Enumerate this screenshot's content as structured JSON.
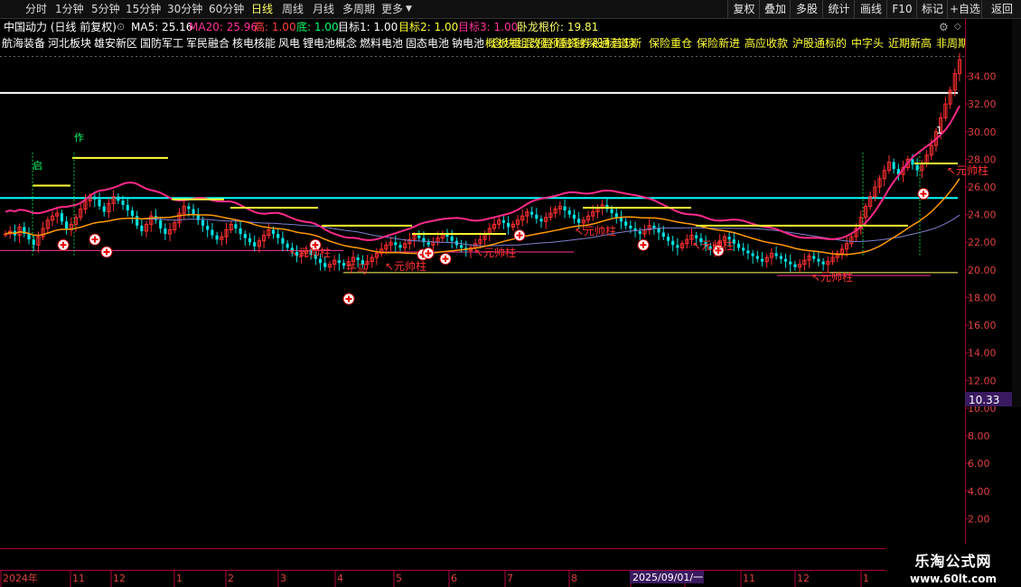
{
  "toolbar": {
    "periods": [
      "分时",
      "1分钟",
      "5分钟",
      "15分钟",
      "30分钟",
      "60分钟",
      "日线",
      "周线",
      "月线",
      "多周期",
      "更多"
    ],
    "active_index": 6,
    "right_buttons": [
      "复权",
      "叠加",
      "多股",
      "统计",
      "画线",
      "F10",
      "标记",
      "+自选",
      "返回"
    ]
  },
  "info": {
    "stock_title": "中国动力 (日线 前复权)",
    "ma5": "MA5: 25.16",
    "ma20": "MA20: 25.96",
    "high": "高: 1.00",
    "low": "底: 1.00",
    "target1": "目标1: 1.00",
    "target2": "目标2: 1.00",
    "target3": "目标3: 1.00",
    "wolong": "卧龙根价: 19.81"
  },
  "sectors": [
    "航海装备",
    "河北板块",
    "雄安新区",
    "国防军工",
    "军民融合",
    "核电核能",
    "风电",
    "锂电池概念",
    "燃料电池",
    "固态电池",
    "钠电池"
  ],
  "sectors_overlap": "概念板块重组混改预盈预增融资融券深股通标普道琼斯",
  "sectors_tail": [
    "保险重仓",
    "保险新进",
    "高应收款",
    "沪股通标的",
    "中字头",
    "近期新高",
    "非周期股"
  ],
  "price_axis": {
    "ticks": [
      "34.00",
      "32.00",
      "30.00",
      "28.00",
      "26.00",
      "24.00",
      "22.00",
      "20.00",
      "18.00",
      "16.00",
      "14.00",
      "12.00",
      "10.00",
      "8.00",
      "6.00",
      "4.00",
      "2.00"
    ],
    "current_tag": "10.33"
  },
  "time_axis": {
    "labels": [
      "2024年",
      "11",
      "12",
      "1",
      "2",
      "3",
      "4",
      "5",
      "6",
      "7",
      "8",
      "9",
      "10",
      "11",
      "12",
      "1"
    ],
    "cursor_label": "2025/09/01/一"
  },
  "annotations": {
    "yuanshuai": "元帅柱",
    "qianma": "千马",
    "zuo": "作",
    "qi": "启",
    "one": "1"
  },
  "colors": {
    "up": "#ff3030",
    "down": "#00e0e0",
    "ma5": "#ff2a8a",
    "ma20": "#ff9900",
    "ma_long": "#7f7fd0",
    "cyan_line": "#00ffff",
    "yellow": "#ffff33",
    "white": "#ffffff"
  },
  "chart_data": {
    "type": "candlestick",
    "ylim": [
      0,
      35.8
    ],
    "start_price": 22.6,
    "closes": [
      22.6,
      22.8,
      22.5,
      23.1,
      22.6,
      22.2,
      21.8,
      22.4,
      23.0,
      23.6,
      23.9,
      24.1,
      23.5,
      22.9,
      23.3,
      23.8,
      24.4,
      25.0,
      25.3,
      25.1,
      24.6,
      24.2,
      24.8,
      25.3,
      25.0,
      24.7,
      24.3,
      23.9,
      23.2,
      22.8,
      23.3,
      23.9,
      23.6,
      23.0,
      22.6,
      22.9,
      23.4,
      24.1,
      24.6,
      24.4,
      24.0,
      23.6,
      23.2,
      22.9,
      22.5,
      22.2,
      22.4,
      22.9,
      23.3,
      23.0,
      22.6,
      22.3,
      22.0,
      21.7,
      22.1,
      22.5,
      22.9,
      22.6,
      22.3,
      21.9,
      21.6,
      21.3,
      21.0,
      21.2,
      21.4,
      21.1,
      20.8,
      20.5,
      20.2,
      20.4,
      20.7,
      20.5,
      20.3,
      20.6,
      20.9,
      20.7,
      20.4,
      20.6,
      20.9,
      21.2,
      21.5,
      21.8,
      22.0,
      21.8,
      21.6,
      21.9,
      22.2,
      22.5,
      22.3,
      22.0,
      21.8,
      22.0,
      22.3,
      22.6,
      22.4,
      22.1,
      21.8,
      21.6,
      21.4,
      21.6,
      21.9,
      22.2,
      22.6,
      23.0,
      23.3,
      23.6,
      23.4,
      23.1,
      23.3,
      23.6,
      23.9,
      24.2,
      24.0,
      23.7,
      23.5,
      23.8,
      24.1,
      24.4,
      24.6,
      24.3,
      24.0,
      23.7,
      23.4,
      23.6,
      23.9,
      24.2,
      24.5,
      24.7,
      24.4,
      24.1,
      23.8,
      23.5,
      23.2,
      23.0,
      22.8,
      22.6,
      22.9,
      23.2,
      23.0,
      22.7,
      22.4,
      22.1,
      21.8,
      21.6,
      21.9,
      22.2,
      22.5,
      22.3,
      22.0,
      21.7,
      21.5,
      21.8,
      22.1,
      22.4,
      22.2,
      21.9,
      21.6,
      21.4,
      21.2,
      21.0,
      20.8,
      20.6,
      20.9,
      21.2,
      21.0,
      20.8,
      20.6,
      20.4,
      20.2,
      20.4,
      20.7,
      21.0,
      20.8,
      20.6,
      20.4,
      20.6,
      20.9,
      21.2,
      21.5,
      21.9,
      22.4,
      23.0,
      23.8,
      24.6,
      25.3,
      26.0,
      26.6,
      27.2,
      27.8,
      27.3,
      26.9,
      27.4,
      28.0,
      27.6,
      27.2,
      27.7,
      28.3,
      29.0,
      30.0,
      31.0,
      32.0,
      33.0,
      34.2,
      35.2
    ],
    "ma_lines": [
      {
        "name": "MA5",
        "color": "#ff2a8a"
      },
      {
        "name": "MA20",
        "color": "#ff9900"
      }
    ],
    "horizontal_levels": [
      {
        "label": "cyan",
        "value": 25.2
      },
      {
        "label": "white",
        "value": 32.8
      },
      {
        "label": "yellow_low",
        "value": 19.8
      }
    ],
    "yuanshuai_count": 6,
    "buy_marks": 12
  }
}
